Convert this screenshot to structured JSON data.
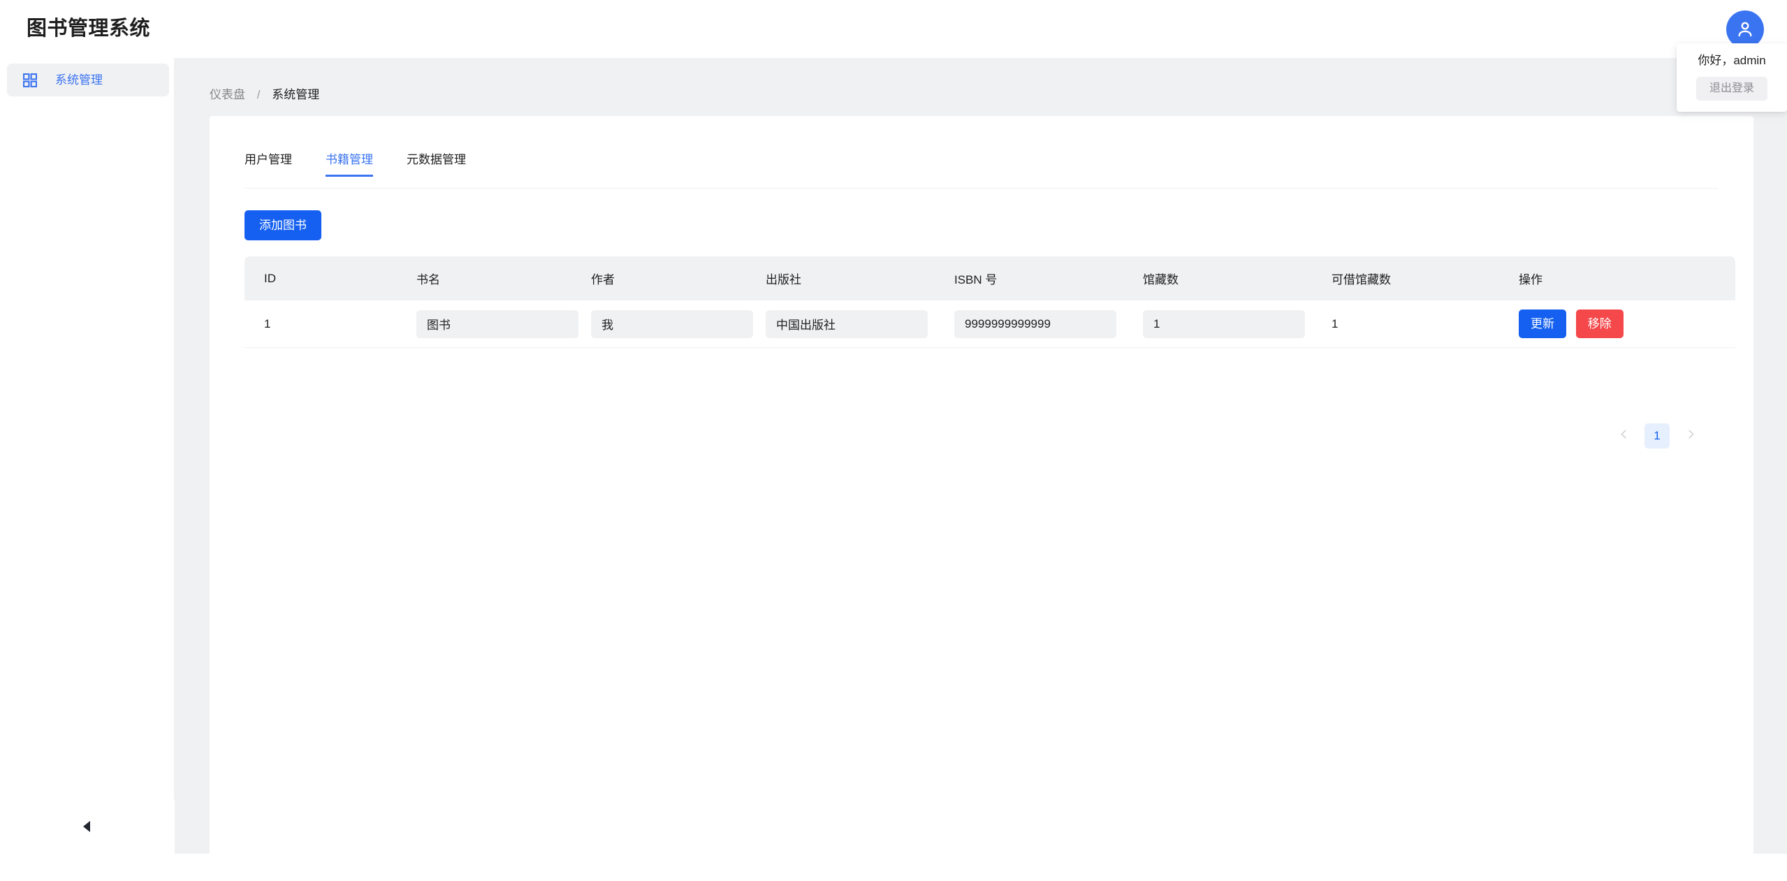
{
  "header": {
    "title": "图书管理系统",
    "avatar_icon": "user-icon"
  },
  "user_menu": {
    "greeting": "你好，admin",
    "logout_label": "退出登录"
  },
  "sidebar": {
    "items": [
      {
        "label": "系统管理",
        "icon": "appstore-grid-icon",
        "active": true
      }
    ],
    "collapse_icon": "caret-left-icon"
  },
  "breadcrumb": {
    "items": [
      "仪表盘",
      "系统管理"
    ],
    "separator": "/"
  },
  "main": {
    "tabs": [
      {
        "label": "用户管理",
        "active": false
      },
      {
        "label": "书籍管理",
        "active": true
      },
      {
        "label": "元数据管理",
        "active": false
      }
    ],
    "add_button_label": "添加图书",
    "table": {
      "columns": [
        "ID",
        "书名",
        "作者",
        "出版社",
        "ISBN 号",
        "馆藏数",
        "可借馆藏数",
        "操作"
      ],
      "rows": [
        {
          "id": "1",
          "title": "图书",
          "author": "我",
          "publisher": "中国出版社",
          "isbn": "9999999999999",
          "stock": "1",
          "available": "1",
          "update_label": "更新",
          "remove_label": "移除"
        }
      ]
    },
    "pagination": {
      "prev_icon": "chevron-left-icon",
      "next_icon": "chevron-right-icon",
      "current_page": "1"
    }
  },
  "colors": {
    "primary": "#1560f0",
    "link": "#3b74f0",
    "danger": "#f4484a",
    "page_bg": "#f0f1f3",
    "card_bg": "#ffffff"
  }
}
